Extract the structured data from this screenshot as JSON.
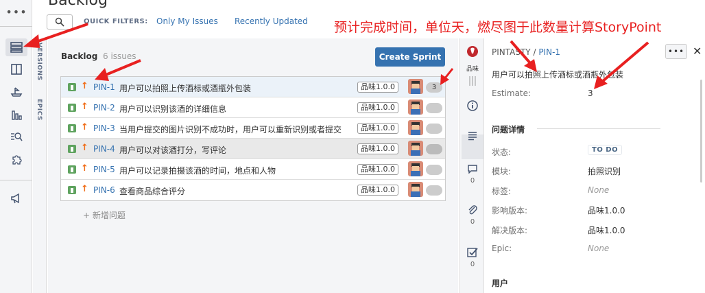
{
  "page": {
    "title": "Backlog"
  },
  "quick_filters": {
    "label": "QUICK FILTERS:",
    "items": [
      "Only My Issues",
      "Recently Updated"
    ]
  },
  "sidebar_tabs": {
    "versions": "VERSIONS",
    "epics": "EPICS"
  },
  "backlog": {
    "title": "Backlog",
    "count": "6 issues",
    "create_sprint": "Create Sprint",
    "issues": [
      {
        "key": "PIN-1",
        "summary": "用户可以拍照上传酒标或酒瓶外包装",
        "version": "品味1.0.0",
        "estimate": "3"
      },
      {
        "key": "PIN-2",
        "summary": "用户可以识别该酒的详细信息",
        "version": "品味1.0.0",
        "estimate": ""
      },
      {
        "key": "PIN-3",
        "summary": "当用户提交的图片识别不成功时，用户可以重新识别或者提交",
        "version": "品味1.0.0",
        "estimate": ""
      },
      {
        "key": "PIN-4",
        "summary": "用户可以对该酒打分，写评论",
        "version": "品味1.0.0",
        "estimate": ""
      },
      {
        "key": "PIN-5",
        "summary": "用户可以记录拍摄该酒的时间，地点和人物",
        "version": "品味1.0.0",
        "estimate": ""
      },
      {
        "key": "PIN-6",
        "summary": "查看商品综合评分",
        "version": "品味1.0.0",
        "estimate": ""
      }
    ],
    "add_issue": "+ 新增问题"
  },
  "detail": {
    "logo_text": "品味",
    "project": "PINTASTY /",
    "key": "PIN-1",
    "summary": "用户可以拍照上传酒标或酒瓶外包装",
    "estimate_label": "Estimate:",
    "estimate_value": "3",
    "section_details": "问题详情",
    "fields": [
      {
        "label": "状态:",
        "value": "TO DO"
      },
      {
        "label": "模块:",
        "value": "拍照识别"
      },
      {
        "label": "标签:",
        "value": "None"
      },
      {
        "label": "影响版本:",
        "value": "品味1.0.0"
      },
      {
        "label": "解决版本:",
        "value": "品味1.0.0"
      },
      {
        "label": "Epic:",
        "value": "None"
      }
    ],
    "section_people": "用户",
    "comment_count": "0",
    "attachment_count": "0",
    "subtask_count": "0"
  },
  "annotation": {
    "text": "预计完成时间，单位天，燃尽图于此数量计算StoryPoint",
    "color": "#e82020"
  },
  "colors": {
    "accent": "#3572b0",
    "story": "#5fa35f",
    "priority": "#f06c17"
  },
  "icons": [
    "more-icon",
    "backlog-icon",
    "board-icon",
    "releases-icon",
    "reports-icon",
    "issues-icon",
    "components-icon",
    "feedback-icon",
    "search-icon",
    "info-icon",
    "description-icon",
    "comment-icon",
    "attachment-icon",
    "subtask-icon",
    "close-icon"
  ]
}
